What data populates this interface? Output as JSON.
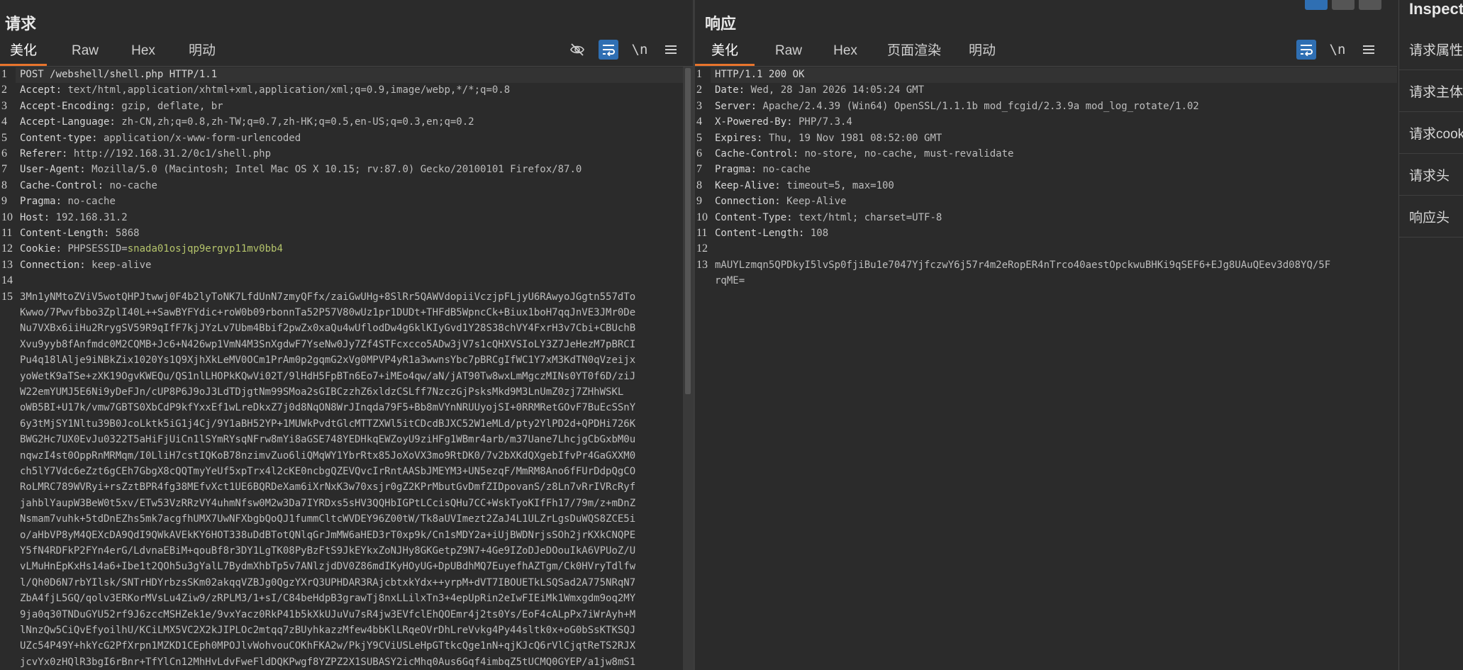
{
  "request": {
    "title": "请求",
    "tabs": [
      "美化",
      "Raw",
      "Hex",
      "明动"
    ],
    "active_tab": 0,
    "tools": {
      "hide": "eye-off-icon",
      "wrap": "wrap-icon",
      "newline": "\\n",
      "menu": "menu-icon"
    },
    "lines": [
      {
        "n": "1",
        "k": "POST /webshell/shell.php HTTP/1.1",
        "v": ""
      },
      {
        "n": "2",
        "k": "Accept:",
        "v": " text/html,application/xhtml+xml,application/xml;q=0.9,image/webp,*/*;q=0.8"
      },
      {
        "n": "3",
        "k": "Accept-Encoding:",
        "v": " gzip, deflate, br"
      },
      {
        "n": "4",
        "k": "Accept-Language:",
        "v": " zh-CN,zh;q=0.8,zh-TW;q=0.7,zh-HK;q=0.5,en-US;q=0.3,en;q=0.2"
      },
      {
        "n": "5",
        "k": "Content-type:",
        "v": " application/x-www-form-urlencoded"
      },
      {
        "n": "6",
        "k": "Referer:",
        "v": " http://192.168.31.2/0c1/shell.php"
      },
      {
        "n": "7",
        "k": "User-Agent:",
        "v": " Mozilla/5.0 (Macintosh; Intel Mac OS X 10.15; rv:87.0) Gecko/20100101 Firefox/87.0"
      },
      {
        "n": "8",
        "k": "Cache-Control:",
        "v": " no-cache"
      },
      {
        "n": "9",
        "k": "Pragma:",
        "v": " no-cache"
      },
      {
        "n": "10",
        "k": "Host:",
        "v": " 192.168.31.2"
      },
      {
        "n": "11",
        "k": "Content-Length:",
        "v": " 5868"
      },
      {
        "n": "12",
        "k": "Cookie:",
        "v": " PHPSESSID=",
        "c": "snada01osjqp9ergvp11mv0bb4"
      },
      {
        "n": "13",
        "k": "Connection:",
        "v": " keep-alive"
      },
      {
        "n": "14",
        "k": "",
        "v": ""
      }
    ],
    "body_line_number": "15",
    "body": [
      "3Mn1yNMtoZViV5wotQHPJtwwj0F4b2lyToNK7LfdUnN7zmyQFfx/zaiGwUHg+8SlRr5QAWVdopiiVczjpFLjyU6RAwyoJGgtn557dTo",
      "Kwwo/7Pwvfbbo3ZplI40L++SawBYFYdic+roW0b09rbonnTa52P57V80wUz1pr1DUDt+THFdB5WpncCk+Biux1boH7qqJnVE3JMr0De",
      "Nu7VXBx6iiHu2RrygSV59R9qIfF7kjJYzLv7Ubm4Bbif2pwZx0xaQu4wUflodDw4g6klKIyGvd1Y28S38chVY4FxrH3v7Cbi+CBUchB",
      "Xvu9yyb8fAnfmdc0M2CQMB+Jc6+N426wp1VmN4M3SnXgdwF7YseNw0Jy7Zf4STFcxcco5ADw3jV7s1cQHXVSIoLY3Z7JeHezM7pBRCI",
      "Pu4q18lAlje9iNBkZix1020Ys1Q9XjhXkLeMV0OCm1PrAm0p2gqmG2xVg0MPVP4yR1a3wwnsYbc7pBRCgIfWC1Y7xM3KdTN0qVzeijx",
      "yoWetK9aTSe+zXK19OgvKWEQu/QS1nlLHOPkKQwVi02T/9lHdH5FpBTn6Eo7+iMEo4qw/aN/jAT90Tw8wxLmMgczMINs0YT0f6D/ziJ",
      "W22emYUMJ5E6Ni9yDeFJn/cUP8P6J9oJ3LdTDjgtNm99SMoa2sGIBCzzhZ6xldzCSLff7NzczGjPsksMkd9M3LnUmZ0zj7ZHhWSKL",
      "oWB5BI+U17k/vmw7GBTS0XbCdP9kfYxxEf1wLreDkxZ7j0d8NqON8WrJInqda79F5+Bb8mVYnNRUUyojSI+0RRMRetGOvF7BuEcSSnY",
      "6y3tMjSY1Nltu39B0JcoLktk5iG1j4Cj/9Y1aBH52YP+1MUWkPvdtGlcMTTZXWl5itCDcdBJXC52W1eMLd/pty2YlPD2d+QPDHi726K",
      "BWG2Hc7UX0EvJu0322T5aHiFjUiCn1lSYmRYsqNFrw8mYi8aGSE748YEDHkqEWZoyU9ziHFg1WBmr4arb/m37Uane7LhcjgCbGxbM0u",
      "nqwzI4st0OppRnMRMqm/I0LliH7cstIQKoB78nzimvZuo6liQMqWY1YbrRtx85JoXoVX3mo9RtDK0/7v2bXKdQXgebIfvPr4GaGXXM0",
      "ch5lY7Vdc6eZzt6gCEh7GbgX8cQQTmyYeUf5xpTrx4l2cKE0ncbgQZEVQvcIrRntAASbJMEYM3+UN5ezqF/MmRM8Ano6fFUrDdpQgCO",
      "RoLMRC789WVRyi+rsZztBPR4fg38MEfvXct1UE6BQRDeXam6iXrNxK3w70xsjr0gZ2KPrMbutGvDmfZIDpovanS/z8Ln7vRrIVRcRyf",
      "jahblYaupW3BeW0t5xv/ETw53VzRRzVY4uhmNfsw0M2w3Da7IYRDxs5sHV3QQHbIGPtLCcisQHu7CC+WskTyoKIfFh17/79m/z+mDnZ",
      "Nsmam7vuhk+5tdDnEZhs5mk7acgfhUMX7UwNFXbgbQoQJ1fummCltcWVDEY96Z00tW/Tk8aUVImezt2ZaJ4L1ULZrLgsDuWQS8ZCE5i",
      "o/aHbVP8yM4QEXcDA9QdI9QWkAVEkKY6HOT338uDdBTotQNlqGrJmMW6aHED3rT0xp9k/Cn1sMDY2a+iUjBWDNrjsSOh2jrKXkCNQPE",
      "Y5fN4RDFkP2FYn4erG/LdvnaEBiM+qouBf8r3DY1LgTK08PyBzFtS9JkEYkxZoNJHy8GKGetpZ9N7+4Ge9IZoDJeDOouIkA6VPUoZ/U",
      "vLMuHnEpKxHs14a6+Ibe1t2QOh5u3gYalL7BydmXhbTp5v7ANlzjdDV0Z86mdIKyHOyUG+DpUBdhMQ7EuyefhAZTgm/Ck0HVryTdlfw",
      "l/Qh0D6N7rbYIlsk/SNTrHDYrbzsSKm02akqqVZBJg0QgzYXrQ3UPHDAR3RAjcbtxkYdx++yrpM+dVT7IBOUETkLSQSad2A775NRqN7",
      "ZbA4fjL5GQ/qolv3ERKorMVsLu4Ziw9/zRPLM3/1+sI/C84beHdpB3grawTj8nxLLilxTn3+4epUpRin2eIwFIEiMk1Wmxgdm9oq2MY",
      "9ja0q30TNDuGYU52rf9J6zccMSHZek1e/9vxYacz0RkP41b5kXkUJuVu7sR4jw3EVfclEhQOEmr4j2ts0Ys/EoF4cALpPx7iWrAyh+M",
      "lNnzQw5CiQvEfyoilhU/KCiLMX5VC2X2kJIPLOc2mtqq7zBUyhkazzMfew4bbKlLRqeOVrDhLreVvkg4Py44sltk0x+oG0bSsKTKSQJ",
      "UZc54P49Y+hkYcG2PfXrpn1MZKD1CEph0MPOJlvWohvouCOKhFKA2w/PkjY9CViUSLeHpGTtkcQge1nN+qjKJcQ6rVlCjqtReTS2RJX",
      "jcvYx0zHQlR3bgI6rBnr+TfYlCn12MhHvLdvFweFldDQKPwgf8YZPZ2X1SUBASY2icMhq0Aus6Gqf4imbqZ5tUCMQ0GYEP/a1jw8mS1"
    ]
  },
  "response": {
    "title": "响应",
    "tabs": [
      "美化",
      "Raw",
      "Hex",
      "页面渲染",
      "明动"
    ],
    "active_tab": 0,
    "tools": {
      "wrap": "wrap-icon",
      "newline": "\\n",
      "menu": "menu-icon"
    },
    "lines": [
      {
        "n": "1",
        "k": "HTTP/1.1 200 OK",
        "v": ""
      },
      {
        "n": "2",
        "k": "Date:",
        "v": " Wed, 28 Jan 2026 14:05:24 GMT"
      },
      {
        "n": "3",
        "k": "Server:",
        "v": " Apache/2.4.39 (Win64) OpenSSL/1.1.1b mod_fcgid/2.3.9a mod_log_rotate/1.02"
      },
      {
        "n": "4",
        "k": "X-Powered-By:",
        "v": " PHP/7.3.4"
      },
      {
        "n": "5",
        "k": "Expires:",
        "v": " Thu, 19 Nov 1981 08:52:00 GMT"
      },
      {
        "n": "6",
        "k": "Cache-Control:",
        "v": " no-store, no-cache, must-revalidate"
      },
      {
        "n": "7",
        "k": "Pragma:",
        "v": " no-cache"
      },
      {
        "n": "8",
        "k": "Keep-Alive:",
        "v": " timeout=5, max=100"
      },
      {
        "n": "9",
        "k": "Connection:",
        "v": " Keep-Alive"
      },
      {
        "n": "10",
        "k": "Content-Type:",
        "v": " text/html; charset=UTF-8"
      },
      {
        "n": "11",
        "k": "Content-Length:",
        "v": " 108"
      },
      {
        "n": "12",
        "k": "",
        "v": ""
      }
    ],
    "body_line_number": "13",
    "body": [
      "mAUYLzmqn5QPDkyI5lvSp0fjiBu1e7047YjfczwY6j57r4m2eRopER4nTrco40aestOpckwuBHKi9qSEF6+EJg8UAuQEev3d08YQ/5F",
      "rqME="
    ]
  },
  "inspector": {
    "title": "Inspector",
    "items": [
      "请求属性",
      "请求主体",
      "请求cookie",
      "请求头",
      "响应头"
    ]
  }
}
